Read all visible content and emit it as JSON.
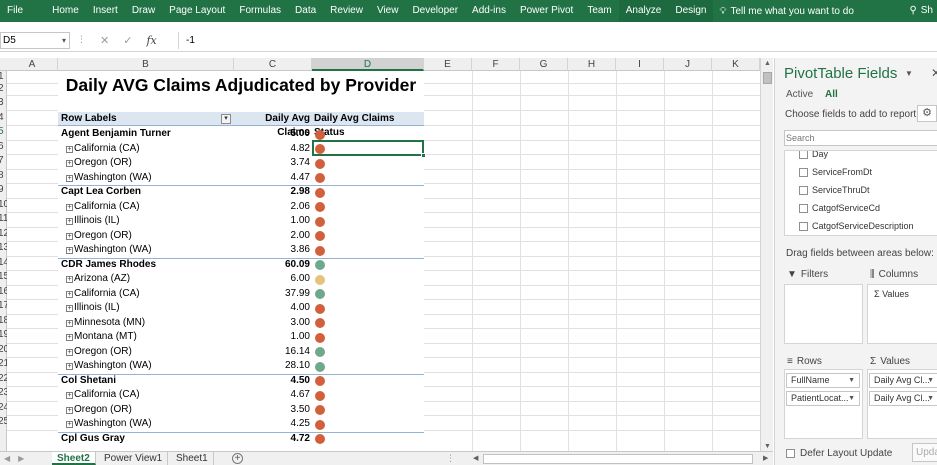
{
  "ribbon": {
    "tabs": [
      "File",
      "Home",
      "Insert",
      "Draw",
      "Page Layout",
      "Formulas",
      "Data",
      "Review",
      "View",
      "Developer",
      "Add-ins",
      "Power Pivot",
      "Team",
      "Analyze",
      "Design"
    ],
    "contextual_tabs": [
      "Analyze",
      "Design"
    ],
    "tell_me": "Tell me what you want to do",
    "user": "Sh",
    "color": "#217346"
  },
  "formula_bar": {
    "name_box": "D5",
    "formula": "-1"
  },
  "columns": [
    "A",
    "B",
    "C",
    "D",
    "E",
    "F",
    "G",
    "H",
    "I",
    "J",
    "K"
  ],
  "rows": [
    "1",
    "2",
    "3",
    "4",
    "5",
    "6",
    "7",
    "8",
    "9",
    "10",
    "11",
    "12",
    "13",
    "14",
    "15",
    "16",
    "17",
    "18",
    "19",
    "20",
    "21",
    "22",
    "23",
    "24",
    "25"
  ],
  "pivot": {
    "title": "Daily AVG Claims Adjudicated by Provider",
    "headers": [
      "Row Labels",
      "Daily Avg Claims",
      "Daily Avg Claims Status"
    ],
    "rows": [
      {
        "label": "Agent Benjamin Turner",
        "value": "5.00",
        "level": 0,
        "status": "red"
      },
      {
        "label": "California (CA)",
        "value": "4.82",
        "level": 1,
        "status": "red"
      },
      {
        "label": "Oregon (OR)",
        "value": "3.74",
        "level": 1,
        "status": "red"
      },
      {
        "label": "Washington (WA)",
        "value": "4.47",
        "level": 1,
        "status": "red"
      },
      {
        "label": "Capt Lea Corben",
        "value": "2.98",
        "level": 0,
        "status": "red"
      },
      {
        "label": "California (CA)",
        "value": "2.06",
        "level": 1,
        "status": "red"
      },
      {
        "label": "Illinois (IL)",
        "value": "1.00",
        "level": 1,
        "status": "red"
      },
      {
        "label": "Oregon (OR)",
        "value": "2.00",
        "level": 1,
        "status": "red"
      },
      {
        "label": "Washington (WA)",
        "value": "3.86",
        "level": 1,
        "status": "red"
      },
      {
        "label": "CDR James Rhodes",
        "value": "60.09",
        "level": 0,
        "status": "green"
      },
      {
        "label": "Arizona (AZ)",
        "value": "6.00",
        "level": 1,
        "status": "yellow"
      },
      {
        "label": "California (CA)",
        "value": "37.99",
        "level": 1,
        "status": "green"
      },
      {
        "label": "Illinois (IL)",
        "value": "4.00",
        "level": 1,
        "status": "red"
      },
      {
        "label": "Minnesota (MN)",
        "value": "3.00",
        "level": 1,
        "status": "red"
      },
      {
        "label": "Montana (MT)",
        "value": "1.00",
        "level": 1,
        "status": "red"
      },
      {
        "label": "Oregon (OR)",
        "value": "16.14",
        "level": 1,
        "status": "green"
      },
      {
        "label": "Washington (WA)",
        "value": "28.10",
        "level": 1,
        "status": "green"
      },
      {
        "label": "Col  Shetani",
        "value": "4.50",
        "level": 0,
        "status": "red"
      },
      {
        "label": "California (CA)",
        "value": "4.67",
        "level": 1,
        "status": "red"
      },
      {
        "label": "Oregon (OR)",
        "value": "3.50",
        "level": 1,
        "status": "red"
      },
      {
        "label": "Washington (WA)",
        "value": "4.25",
        "level": 1,
        "status": "red"
      },
      {
        "label": "Cpl Gus Gray",
        "value": "4.72",
        "level": 0,
        "status": "red"
      }
    ],
    "status_colors": {
      "red": "#d1603d",
      "green": "#6fa88a",
      "yellow": "#e8c27a"
    },
    "header_fill": "#dce6f1"
  },
  "sheets": {
    "tabs": [
      "Sheet2",
      "Power View1",
      "Sheet1"
    ],
    "active": "Sheet2"
  },
  "pane": {
    "title": "PivotTable Fields",
    "tab_active": "Active",
    "tab_all": "All",
    "choose_label": "Choose fields to add to report:",
    "search_placeholder": "Search",
    "fields": [
      "Day",
      "ServiceFromDt",
      "ServiceThruDt",
      "CatgofServiceCd",
      "CatgofServiceDescription"
    ],
    "drag_label": "Drag fields between areas below:",
    "filters_label": "Filters",
    "columns_label": "Columns",
    "columns_item": "Values",
    "rows_label": "Rows",
    "values_label": "Values",
    "rows_items": [
      "FullName",
      "PatientLocat..."
    ],
    "values_items": [
      "Daily Avg Cl...",
      "Daily Avg Cl..."
    ],
    "defer_label": "Defer Layout Update",
    "update_label": "Upda"
  }
}
